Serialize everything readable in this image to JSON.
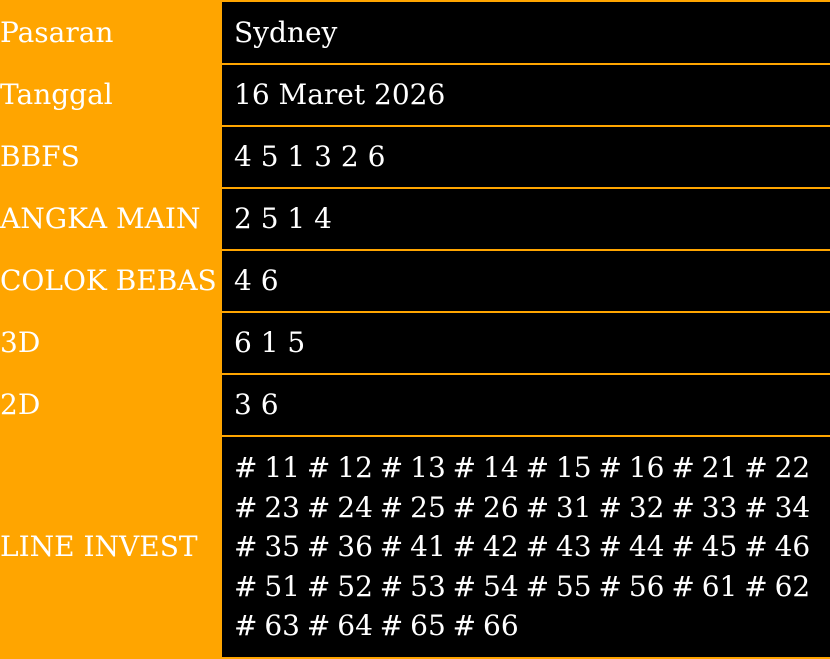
{
  "rows": [
    {
      "label": "Pasaran",
      "value": "Sydney"
    },
    {
      "label": "Tanggal",
      "value": "16 Maret 2026"
    },
    {
      "label": "BBFS",
      "value": "4 5 1 3 2 6"
    },
    {
      "label": "ANGKA MAIN",
      "value": "2 5 1 4"
    },
    {
      "label": "COLOK BEBAS",
      "value": "4 6"
    },
    {
      "label": "3D",
      "value": "6 1 5"
    },
    {
      "label": "2D",
      "value": "3 6"
    },
    {
      "label": "LINE INVEST",
      "value": "# 11 # 12 # 13 # 14 # 15 # 16 # 21 # 22 # 23 # 24 # 25 # 26 # 31 # 32 # 33 # 34 # 35 # 36 # 41 # 42 # 43 # 44 # 45 # 46 # 51 # 52 # 53 # 54 # 55 # 56 # 61 # 62 # 63 # 64 # 65 # 66"
    }
  ],
  "colors": {
    "label_bg": "#ffa500",
    "value_bg": "#000000",
    "text": "#ffffff"
  }
}
